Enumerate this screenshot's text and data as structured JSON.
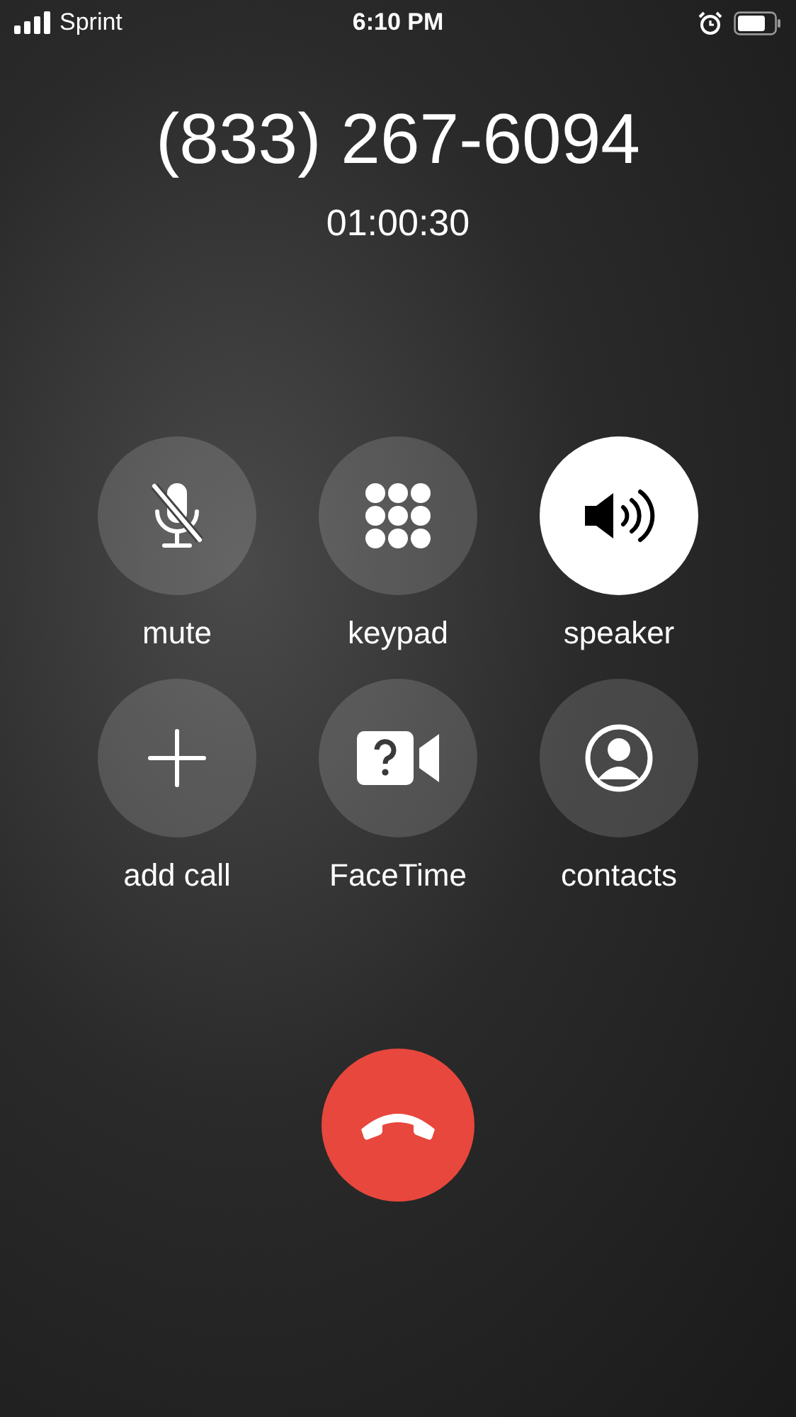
{
  "status_bar": {
    "carrier": "Sprint",
    "time": "6:10 PM",
    "alarm": true
  },
  "call": {
    "number": "(833) 267-6094",
    "duration": "01:00:30"
  },
  "buttons": [
    {
      "kind": "mute",
      "label": "mute",
      "on": false
    },
    {
      "kind": "keypad",
      "label": "keypad",
      "on": false
    },
    {
      "kind": "speaker",
      "label": "speaker",
      "on": true
    },
    {
      "kind": "add",
      "label": "add call",
      "on": false
    },
    {
      "kind": "facetime",
      "label": "FaceTime",
      "on": false
    },
    {
      "kind": "contacts",
      "label": "contacts",
      "on": false
    }
  ]
}
